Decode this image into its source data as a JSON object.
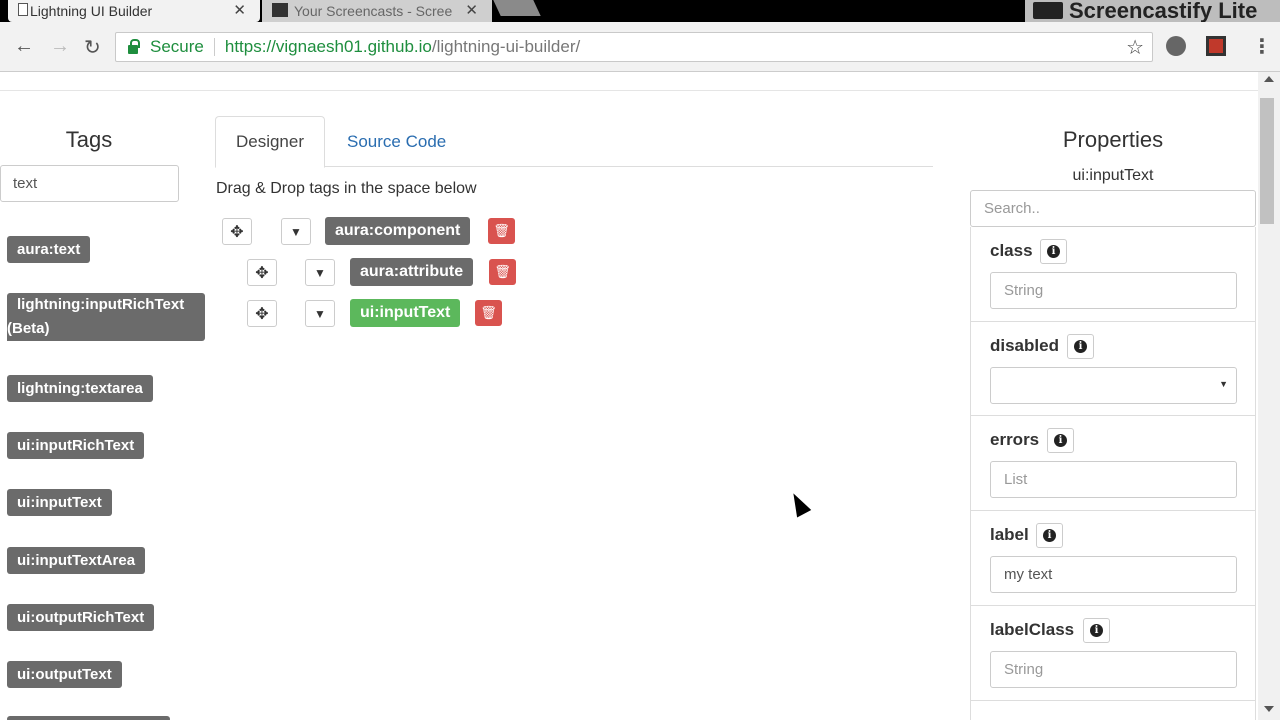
{
  "browser": {
    "tabs": [
      {
        "title": "Lightning UI Builder"
      },
      {
        "title": "Your Screencasts - Scree"
      }
    ],
    "close_glyph": "✕",
    "extension_banner": "Screencastify Lite",
    "secure_label": "Secure",
    "url_host": "https://vignaesh01.github.io",
    "url_path": "/lightning-ui-builder/"
  },
  "tags_panel": {
    "title": "Tags",
    "search_value": "text",
    "items": [
      "aura:text",
      "lightning:inputRichText",
      "(Beta)",
      "lightning:textarea",
      "ui:inputRichText",
      "ui:inputText",
      "ui:inputTextArea",
      "ui:outputRichText",
      "ui:outputText"
    ]
  },
  "designer": {
    "tabs": [
      "Designer",
      "Source Code"
    ],
    "hint": "Drag & Drop tags in the space below",
    "tree": [
      {
        "label": "aura:component",
        "selected": false
      },
      {
        "label": "aura:attribute",
        "selected": false
      },
      {
        "label": "ui:inputText",
        "selected": true
      }
    ]
  },
  "properties_panel": {
    "title": "Properties",
    "component": "ui:inputText",
    "search_placeholder": "Search..",
    "props": [
      {
        "name": "class",
        "value": "String"
      },
      {
        "name": "disabled",
        "value": ""
      },
      {
        "name": "errors",
        "value": "List"
      },
      {
        "name": "label",
        "value": "my text"
      },
      {
        "name": "labelClass",
        "value": "String"
      }
    ]
  },
  "colors": {
    "tag_gray": "#6b6b6b",
    "selected_green": "#5cb85c",
    "delete_red": "#d9534f",
    "link_blue": "#2a6db0",
    "secure_green": "#1e8e3e"
  },
  "icons": {
    "move": "move-icon",
    "dropdown": "chevron-down-icon",
    "delete": "trash-icon",
    "info": "info-icon",
    "lock": "lock-icon",
    "star": "star-icon"
  }
}
